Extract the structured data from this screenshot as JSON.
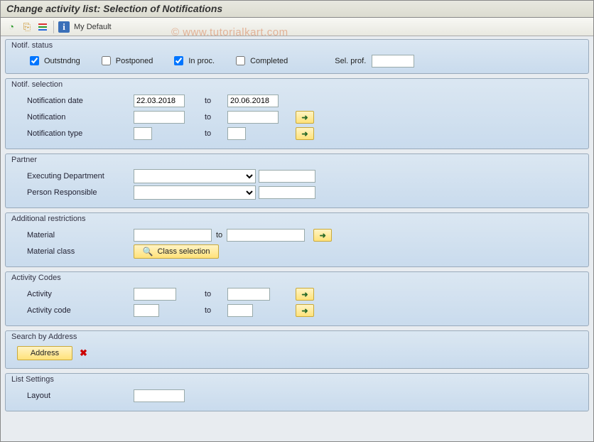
{
  "title": "Change activity list: Selection of Notifications",
  "watermark": "© www.tutorialkart.com",
  "toolbar": {
    "my_default": "My Default"
  },
  "groups": {
    "notif_status": {
      "title": "Notif. status",
      "outstanding_label": "Outstndng",
      "outstanding_checked": true,
      "postponed_label": "Postponed",
      "postponed_checked": false,
      "in_proc_label": "In proc.",
      "in_proc_checked": true,
      "completed_label": "Completed",
      "completed_checked": false,
      "sel_prof_label": "Sel. prof.",
      "sel_prof_value": ""
    },
    "notif_selection": {
      "title": "Notif. selection",
      "date_label": "Notification date",
      "date_from": "22.03.2018",
      "date_to": "20.06.2018",
      "notif_label": "Notification",
      "notif_from": "",
      "notif_to": "",
      "type_label": "Notification type",
      "type_from": "",
      "type_to": "",
      "to": "to"
    },
    "partner": {
      "title": "Partner",
      "exec_dept_label": "Executing Department",
      "exec_dept_value": "",
      "person_resp_label": "Person Responsible",
      "person_resp_value": ""
    },
    "additional": {
      "title": "Additional restrictions",
      "material_label": "Material",
      "material_from": "",
      "material_to": "",
      "material_class_label": "Material class",
      "class_sel_btn": "Class selection",
      "to": "to"
    },
    "activity_codes": {
      "title": "Activity Codes",
      "activity_label": "Activity",
      "activity_from": "",
      "activity_to": "",
      "activity_code_label": "Activity code",
      "activity_code_from": "",
      "activity_code_to": "",
      "to": "to"
    },
    "search_address": {
      "title": "Search by Address",
      "address_btn": "Address"
    },
    "list_settings": {
      "title": "List Settings",
      "layout_label": "Layout",
      "layout_value": ""
    }
  }
}
